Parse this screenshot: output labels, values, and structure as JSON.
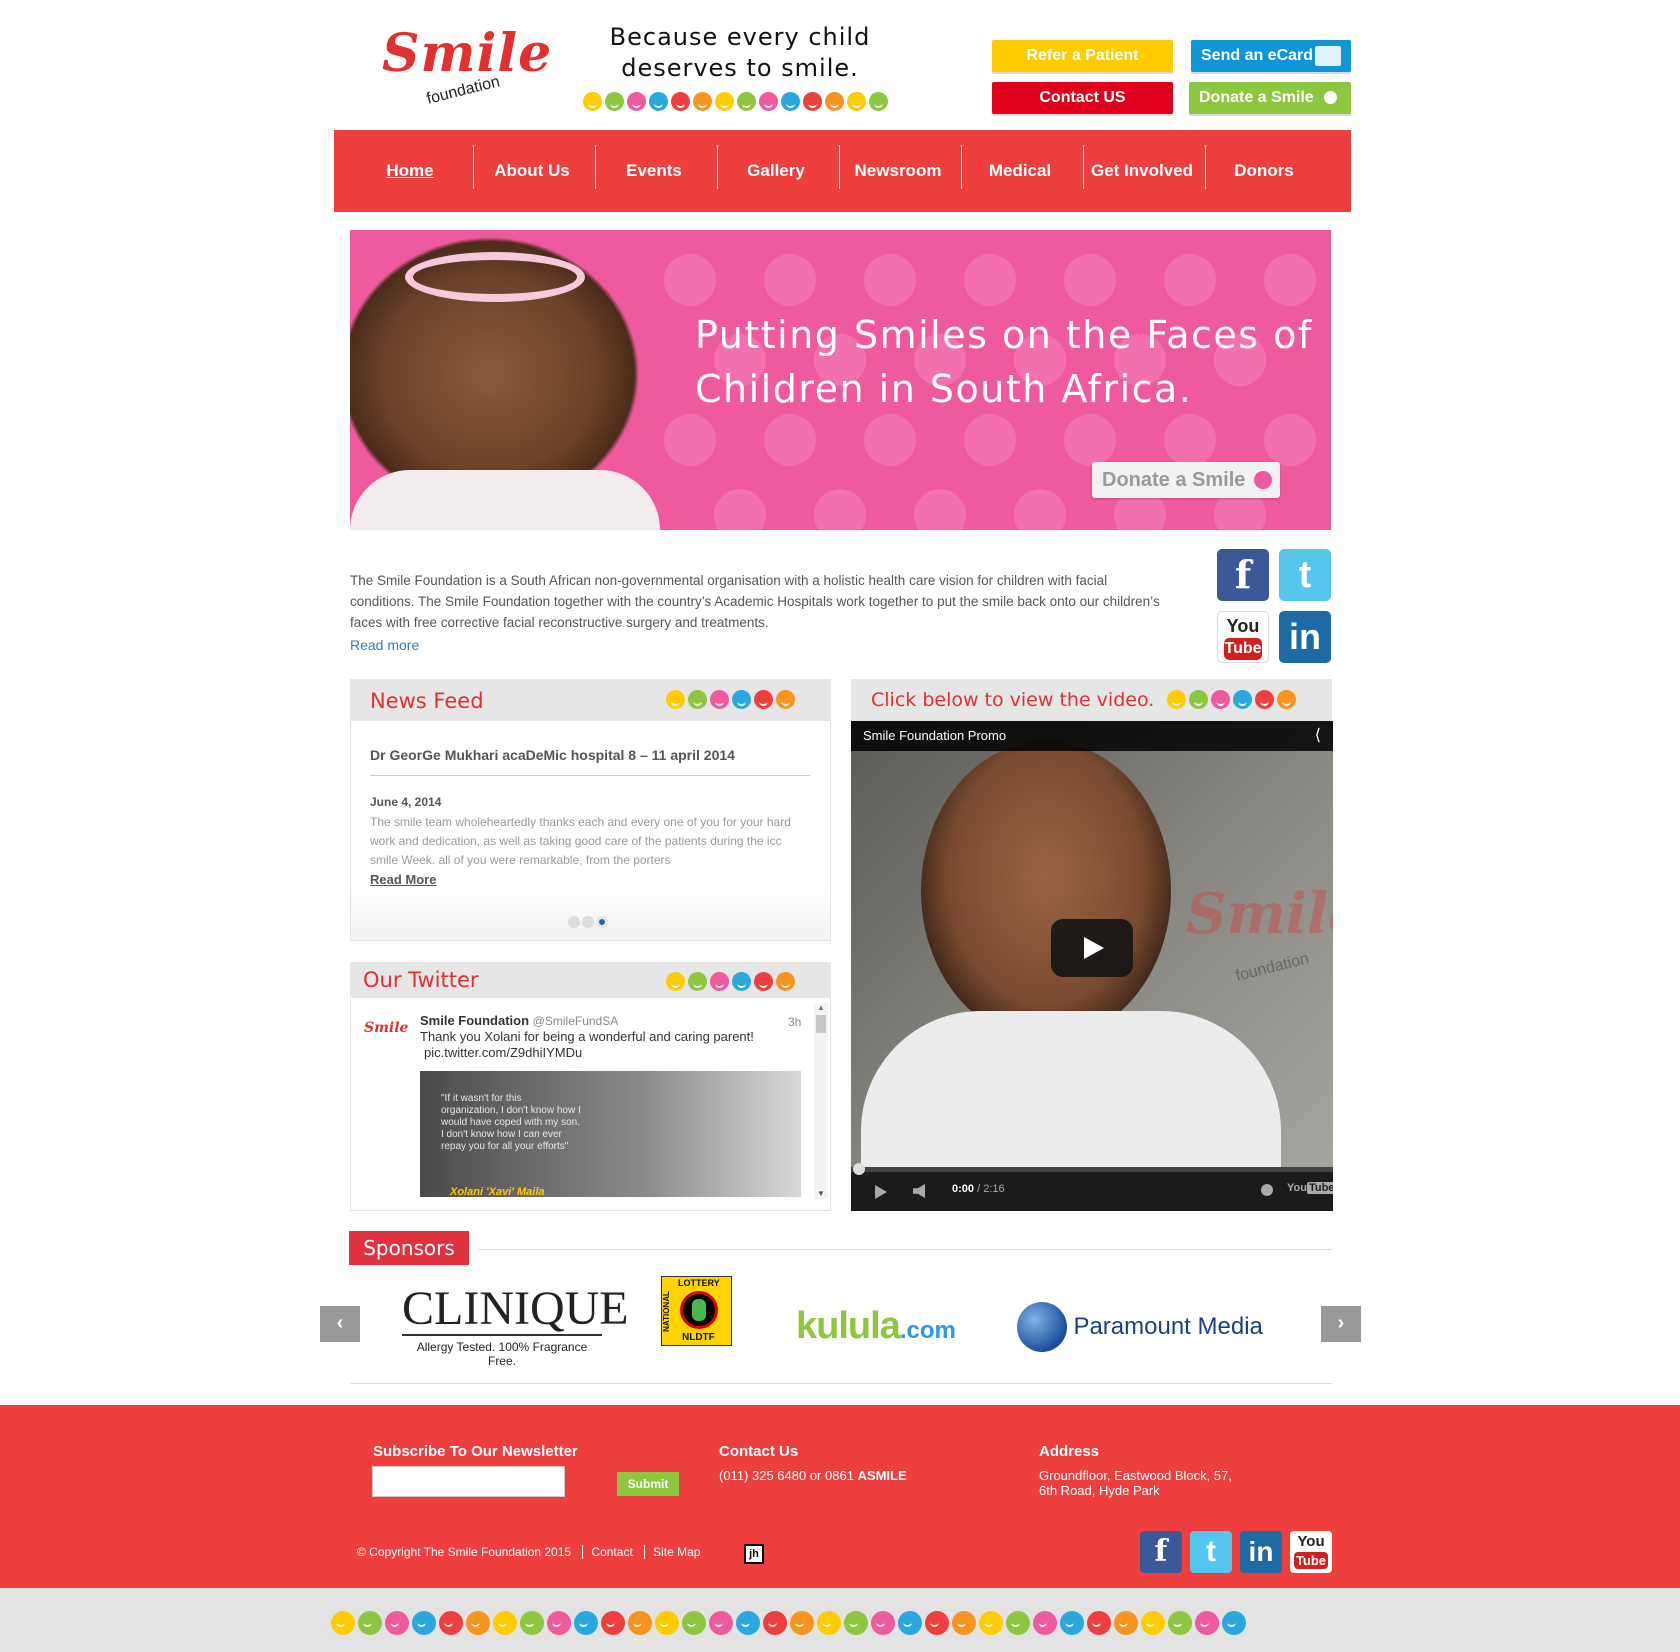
{
  "header": {
    "logo_text": "Smile",
    "logo_sub": "foundation",
    "tagline_line1": "Because every child",
    "tagline_line2": "deserves to smile.",
    "buttons": {
      "refer": "Refer a Patient",
      "ecard": "Send an eCard",
      "contact": "Contact US",
      "donate": "Donate a Smile"
    }
  },
  "nav": {
    "items": [
      "Home",
      "About Us",
      "Events",
      "Gallery",
      "Newsroom",
      "Medical",
      "Get Involved",
      "Donors"
    ]
  },
  "hero": {
    "line1": "Putting Smiles on the Faces of",
    "line2": "Children in South Africa.",
    "donate_button": "Donate a Smile"
  },
  "intro": {
    "text": "The Smile Foundation is a South African non-governmental organisation with a holistic health care vision for children with facial conditions. The Smile Foundation together with the country’s Academic Hospitals work together to put the smile back onto our children’s faces with free corrective facial reconstructive surgery and treatments.",
    "read_more": "Read more"
  },
  "social_top": {
    "facebook": "f",
    "twitter": "t",
    "youtube_top": "You",
    "youtube_bottom": "Tube",
    "linkedin": "in"
  },
  "news": {
    "title": "News Feed",
    "headline": "Dr GeorGe Mukhari acaDeMic hospital 8 – 11 april 2014",
    "date": "June 4, 2014",
    "body": "The smile team wholeheartedly thanks each and every one of you for your hard work and dedication, as well as taking good care of the patients during the icc smile Week. all of you were remarkable, from the porters",
    "read_more": "Read More"
  },
  "twitter": {
    "title": "Our Twitter",
    "account": "Smile Foundation",
    "handle": "@SmileFundSA",
    "time": "3h",
    "tweet": "Thank you Xolani for being a wonderful and caring parent!",
    "link": "pic.twitter.com/Z9dhiIYMDu",
    "quote": "\"If it wasn't for this organization, I don't know how I would have coped with my son. I don't know how I can ever repay you for all your efforts\"",
    "quote_author": "Xolani 'Xavi' Maila"
  },
  "video": {
    "title": "Click below to view the video.",
    "player_title": "Smile Foundation Promo",
    "time_current": "0:00",
    "time_total": "/ 2:16",
    "watermark_top": "Smile",
    "watermark_bottom": "foundation",
    "yt_you": "You",
    "yt_tube": "Tube"
  },
  "sponsors": {
    "title": "Sponsors",
    "clinique": "CLINIQUE",
    "clinique_sub": "Allergy Tested. 100% Fragrance Free.",
    "lottery_top": "LOTTERY",
    "lottery_side": "NATIONAL",
    "lottery_bottom": "NLDTF",
    "kulula": "kulula",
    "kulula_com": ".com",
    "paramount": "Paramount Media"
  },
  "footer": {
    "newsletter_title": "Subscribe To Our Newsletter",
    "submit": "Submit",
    "contact_title": "Contact Us",
    "contact_phone": "(011) 325 6480 or 0861 ",
    "contact_asmile": "ASMILE",
    "address_title": "Address",
    "address_line1": "Groundfloor, Eastwood Block, 57,",
    "address_line2": "6th Road, Hyde Park",
    "copyright": "© Copyright The Smile Foundation 2015",
    "link_contact": "Contact",
    "link_sitemap": "Site Map",
    "credit": "jh"
  },
  "colors": {
    "brand_red": "#ee3e3e",
    "pink": "#ef5a9f",
    "yellow": "#ffcc00",
    "blue": "#0f95d8",
    "green": "#8dc63f"
  }
}
